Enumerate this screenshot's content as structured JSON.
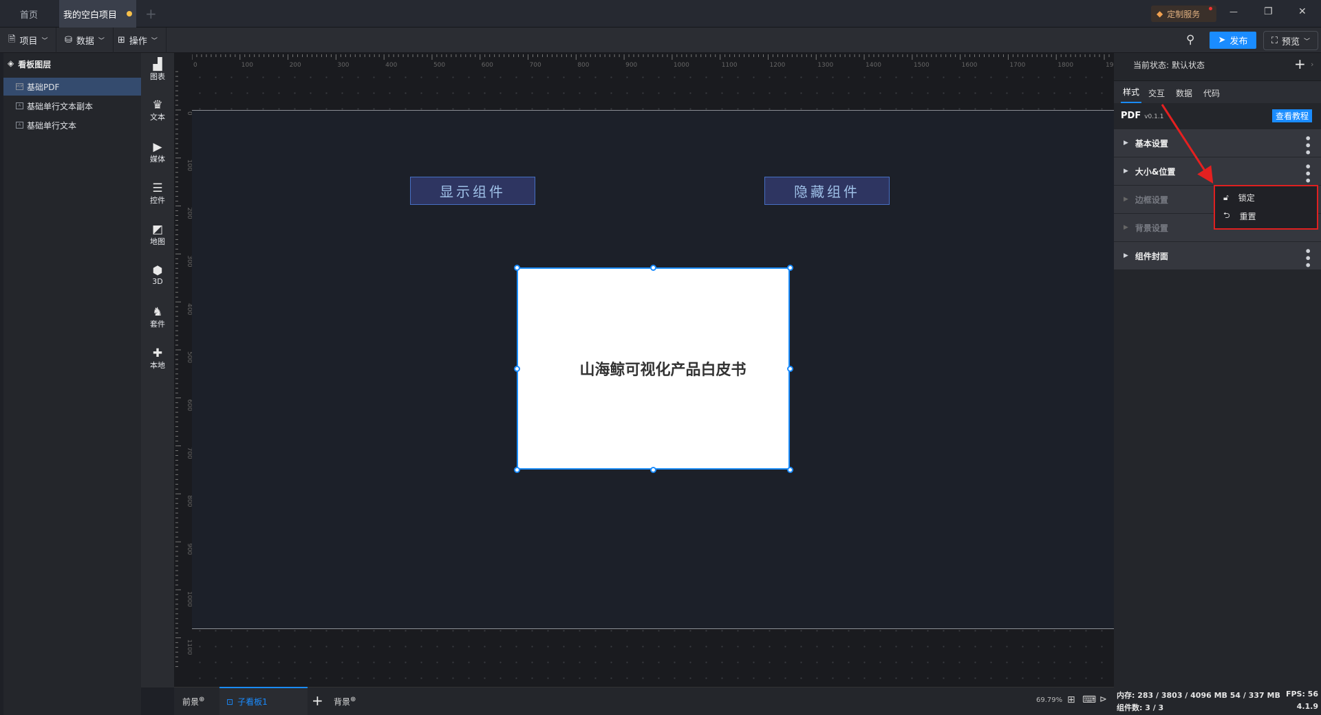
{
  "titlebar": {
    "tabs": [
      {
        "label": "首页"
      },
      {
        "label": "我的空白项目",
        "unsaved": true
      }
    ],
    "new_tab": "+",
    "service_label": "定制服务",
    "controls": {
      "minimize": "—",
      "restore": "❐",
      "close": "✕"
    }
  },
  "toolbar": {
    "menus": [
      {
        "label": "项目",
        "icon": "file-icon"
      },
      {
        "label": "数据",
        "icon": "database-icon"
      },
      {
        "label": "操作",
        "icon": "grid-icon"
      }
    ],
    "publish_label": "发布",
    "preview_label": "预览"
  },
  "layers": {
    "title": "看板图层",
    "items": [
      {
        "label": "基础PDF",
        "selected": true
      },
      {
        "label": "基础单行文本副本"
      },
      {
        "label": "基础单行文本"
      }
    ]
  },
  "components": [
    {
      "label": "图表",
      "glyph": "▟"
    },
    {
      "label": "文本",
      "glyph": "♛"
    },
    {
      "label": "媒体",
      "glyph": "▶"
    },
    {
      "label": "控件",
      "glyph": "☰"
    },
    {
      "label": "地图",
      "glyph": "◩"
    },
    {
      "label": "3D",
      "glyph": "⬢"
    },
    {
      "label": "套件",
      "glyph": "♞"
    },
    {
      "label": "本地",
      "glyph": "✚"
    }
  ],
  "canvas": {
    "show_button": "显示组件",
    "hide_button": "隐藏组件",
    "pdf_title": "山海鲸可视化产品白皮书"
  },
  "bottombar": {
    "foreground": "前景",
    "sub_board": "子看板1",
    "add": "+",
    "background": "背景",
    "zoom": "69.79%"
  },
  "rightpanel": {
    "state_label": "当前状态:",
    "state_value": "默认状态",
    "tabs": [
      "样式",
      "交互",
      "数据",
      "代码"
    ],
    "active_tab": "样式",
    "component_name": "PDF",
    "version": "v0.1.1",
    "tutorial_label": "查看教程",
    "sections": [
      {
        "label": "基本设置"
      },
      {
        "label": "大小&位置"
      },
      {
        "label": "边框设置"
      },
      {
        "label": "背景设置"
      },
      {
        "label": "组件封面"
      }
    ],
    "context_menu": [
      {
        "label": "锁定",
        "icon": "lock-icon"
      },
      {
        "label": "重置",
        "icon": "reset-icon"
      }
    ]
  },
  "status": {
    "memory": "内存: 283 / 3803 / 4096 MB  54 / 337 MB",
    "fps": "FPS:  56",
    "components": "组件数: 3 / 3",
    "version": "4.1.9"
  },
  "colors": {
    "accent": "#1a8cff",
    "highlight": "#e02020"
  }
}
